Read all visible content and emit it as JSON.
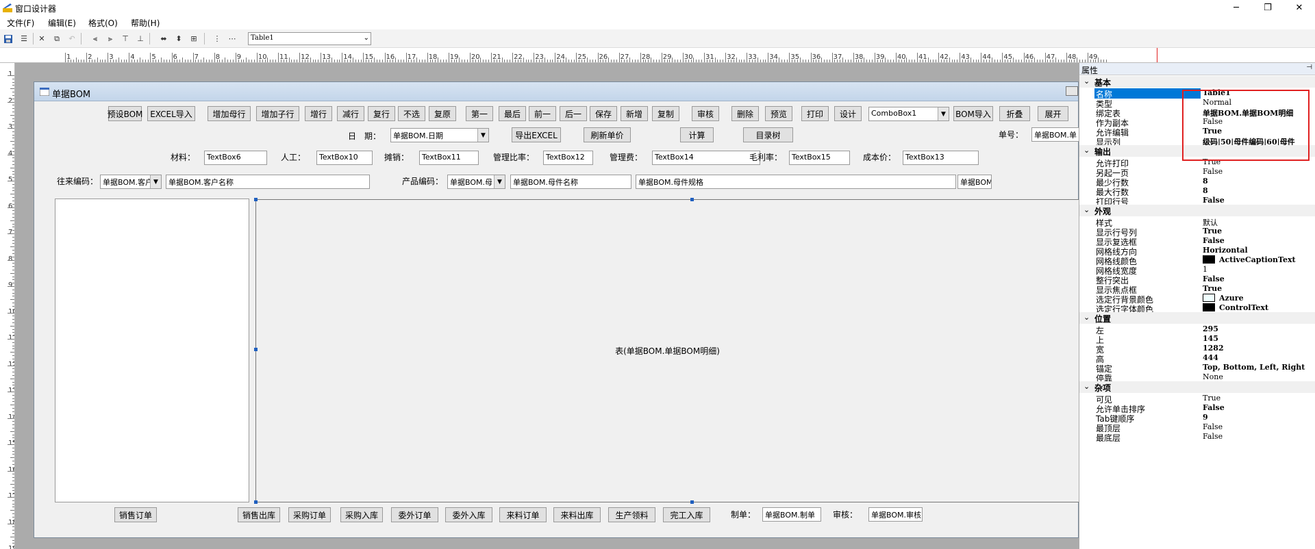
{
  "window": {
    "title": "窗口设计器"
  },
  "menu": [
    "文件(F)",
    "编辑(E)",
    "格式(O)",
    "帮助(H)"
  ],
  "toolbar": {
    "object_selector": "Table1"
  },
  "ruler": {
    "h": [
      "1",
      "2",
      "3",
      "4",
      "5",
      "6",
      "7",
      "8",
      "9",
      "10",
      "11",
      "12",
      "13",
      "14",
      "15",
      "16",
      "17",
      "18",
      "19",
      "20",
      "21",
      "22",
      "23",
      "24",
      "25",
      "26",
      "27",
      "28",
      "29",
      "30",
      "31",
      "32",
      "33",
      "34",
      "35",
      "36",
      "37",
      "38",
      "39",
      "40",
      "41",
      "42",
      "43",
      "44",
      "45",
      "46",
      "47",
      "48",
      "49"
    ],
    "v": [
      "1",
      "2",
      "3",
      "4",
      "5",
      "6",
      "7",
      "8",
      "9",
      "10",
      "11",
      "12",
      "13",
      "14",
      "15",
      "16",
      "17",
      "18",
      "19"
    ]
  },
  "form": {
    "title": "单据BOM",
    "top_buttons": [
      "预设BOM",
      "EXCEL导入",
      "增加母行",
      "增加子行",
      "增行",
      "减行",
      "复行",
      "不选",
      "复原",
      "第一",
      "最后",
      "前一",
      "后一",
      "保存",
      "新增",
      "复制",
      "审核",
      "删除",
      "预览",
      "打印",
      "设计"
    ],
    "combo1": "ComboBox1",
    "bom_import": "BOM导入",
    "fold": "折叠",
    "expand": "展开",
    "date_label": "日　期：",
    "date_value": "单据BOM.日期",
    "export_excel": "导出EXCEL",
    "refresh_price": "刷新单价",
    "calc": "计算",
    "catalog_tree": "目录树",
    "doc_no_label": "单号：",
    "doc_no_value": "单据BOM.单",
    "material_label": "材料：",
    "material_value": "TextBox6",
    "labor_label": "人工：",
    "labor_value": "TextBox10",
    "share_label": "摊销：",
    "share_value": "TextBox11",
    "mgmt_ratio_label": "管理比率：",
    "mgmt_ratio_value": "TextBox12",
    "mgmt_fee_label": "管理费：",
    "mgmt_fee_value": "TextBox14",
    "gross_label": "毛利率：",
    "gross_value": "TextBox15",
    "cost_label": "成本价：",
    "cost_value": "TextBox13",
    "partner_label": "往来编码：",
    "partner_code": "单据BOM.客户",
    "partner_name": "单据BOM.客户名称",
    "product_label": "产品编码：",
    "product_code": "单据BOM.母",
    "parent_name": "单据BOM.母件名称",
    "parent_spec": "单据BOM.母件规格",
    "extra_field": "单据BOM.",
    "table_caption": "表(单据BOM.单据BOM明细)",
    "bottom_buttons": [
      "销售订单",
      "销售出库",
      "采购订单",
      "采购入库",
      "委外订单",
      "委外入库",
      "来料订单",
      "来料出库",
      "生产领料",
      "完工入库"
    ],
    "maker_label": "制单：",
    "maker_value": "单据BOM.制单",
    "auditor_label": "审核：",
    "auditor_value": "单据BOM.审核"
  },
  "properties": {
    "header": "属性",
    "categories": [
      {
        "name": "基本",
        "rows": [
          {
            "name": "名称",
            "value": "Table1",
            "bold": true,
            "selected": true
          },
          {
            "name": "类型",
            "value": "Normal"
          },
          {
            "name": "绑定表",
            "value": "单据BOM.单据BOM明细",
            "bold": true
          },
          {
            "name": "作为副本",
            "value": "False"
          },
          {
            "name": "允许编辑",
            "value": "True",
            "bold": true
          },
          {
            "name": "显示列",
            "value": "级码|50|母件编码|60|母件",
            "bold": true
          }
        ]
      },
      {
        "name": "输出",
        "rows": [
          {
            "name": "允许打印",
            "value": "True"
          },
          {
            "name": "另起一页",
            "value": "False"
          },
          {
            "name": "最少行数",
            "value": "8",
            "bold": true
          },
          {
            "name": "最大行数",
            "value": "8",
            "bold": true
          },
          {
            "name": "打印行号",
            "value": "False",
            "bold": true
          }
        ]
      },
      {
        "name": "外观",
        "rows": [
          {
            "name": "样式",
            "value": "默认"
          },
          {
            "name": "显示行号列",
            "value": "True",
            "bold": true
          },
          {
            "name": "显示复选框",
            "value": "False",
            "bold": true
          },
          {
            "name": "网格线方向",
            "value": "Horizontal",
            "bold": true
          },
          {
            "name": "网格线颜色",
            "value": "ActiveCaptionText",
            "bold": true,
            "swatch": "#000000"
          },
          {
            "name": "网格线宽度",
            "value": "1"
          },
          {
            "name": "整行突出",
            "value": "False",
            "bold": true
          },
          {
            "name": "显示焦点框",
            "value": "True",
            "bold": true
          },
          {
            "name": "选定行背景颜色",
            "value": "Azure",
            "bold": true,
            "swatch": "#F0FFFF"
          },
          {
            "name": "选定行字体颜色",
            "value": "ControlText",
            "bold": true,
            "swatch": "#000000"
          }
        ]
      },
      {
        "name": "位置",
        "rows": [
          {
            "name": "左",
            "value": "295",
            "bold": true
          },
          {
            "name": "上",
            "value": "145",
            "bold": true
          },
          {
            "name": "宽",
            "value": "1282",
            "bold": true
          },
          {
            "name": "高",
            "value": "444",
            "bold": true
          },
          {
            "name": "锚定",
            "value": "Top, Bottom, Left, Right",
            "bold": true
          },
          {
            "name": "停靠",
            "value": "None"
          }
        ]
      },
      {
        "name": "杂项",
        "rows": [
          {
            "name": "可见",
            "value": "True"
          },
          {
            "name": "允许单击排序",
            "value": "False",
            "bold": true
          },
          {
            "name": "Tab键顺序",
            "value": "9",
            "bold": true
          },
          {
            "name": "最顶层",
            "value": "False"
          },
          {
            "name": "最底层",
            "value": "False"
          }
        ]
      }
    ]
  },
  "colors": {
    "selection": "#0078d7",
    "highlight_box": "#e02020",
    "design_bg": "#ababab"
  }
}
